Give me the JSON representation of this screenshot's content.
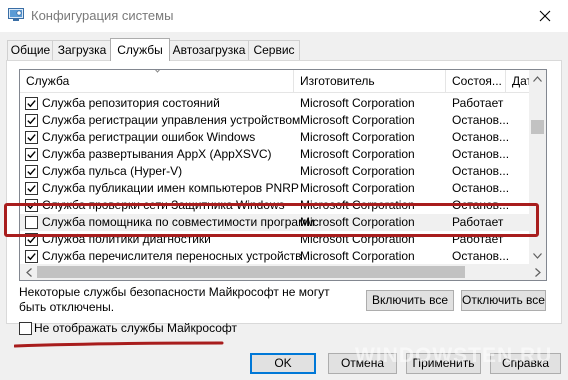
{
  "window": {
    "title": "Конфигурация системы",
    "close_icon": "close-icon"
  },
  "tabs": [
    {
      "label": "Общие",
      "active": false
    },
    {
      "label": "Загрузка",
      "active": false
    },
    {
      "label": "Службы",
      "active": true
    },
    {
      "label": "Автозагрузка",
      "active": false
    },
    {
      "label": "Сервис",
      "active": false
    }
  ],
  "table": {
    "columns": [
      "Служба",
      "Изготовитель",
      "Состоя...",
      "Дат"
    ],
    "rows": [
      {
        "checked": true,
        "name": "Служба репозитория состояний",
        "vendor": "Microsoft Corporation",
        "state": "Работает"
      },
      {
        "checked": true,
        "name": "Служба регистрации управления устройством",
        "vendor": "Microsoft Corporation",
        "state": "Останов..."
      },
      {
        "checked": true,
        "name": "Служба регистрации ошибок Windows",
        "vendor": "Microsoft Corporation",
        "state": "Останов..."
      },
      {
        "checked": true,
        "name": "Служба развертывания AppX (AppXSVC)",
        "vendor": "Microsoft Corporation",
        "state": "Останов..."
      },
      {
        "checked": true,
        "name": "Служба пульса (Hyper-V)",
        "vendor": "Microsoft Corporation",
        "state": "Останов..."
      },
      {
        "checked": true,
        "name": "Служба публикации имен компьютеров PNRP",
        "vendor": "Microsoft Corporation",
        "state": "Останов..."
      },
      {
        "checked": true,
        "name": "Служба проверки сети Защитника Windows",
        "vendor": "Microsoft Corporation",
        "state": "Останов..."
      },
      {
        "checked": false,
        "name": "Служба помощника по совместимости программ",
        "vendor": "Microsoft Corporation",
        "state": "Работает"
      },
      {
        "checked": true,
        "name": "Служба политики диагностики",
        "vendor": "Microsoft Corporation",
        "state": "Работает"
      },
      {
        "checked": true,
        "name": "Служба перечислителя переносных устройств",
        "vendor": "Microsoft Corporation",
        "state": "Останов..."
      }
    ]
  },
  "notice": "Некоторые службы безопасности Майкрософт не могут быть отключены.",
  "buttons": {
    "enable_all": "Включить все",
    "disable_all": "Отключить все",
    "ok": "OK",
    "cancel": "Отмена",
    "apply": "Применить",
    "help": "Справка"
  },
  "hide_ms": {
    "label": "Не отображать службы Майкрософт",
    "checked": false
  },
  "watermark": "WINDOWSTEN.RU",
  "colors": {
    "annotation": "#a81d1d",
    "default_button_border": "#0078d7"
  }
}
